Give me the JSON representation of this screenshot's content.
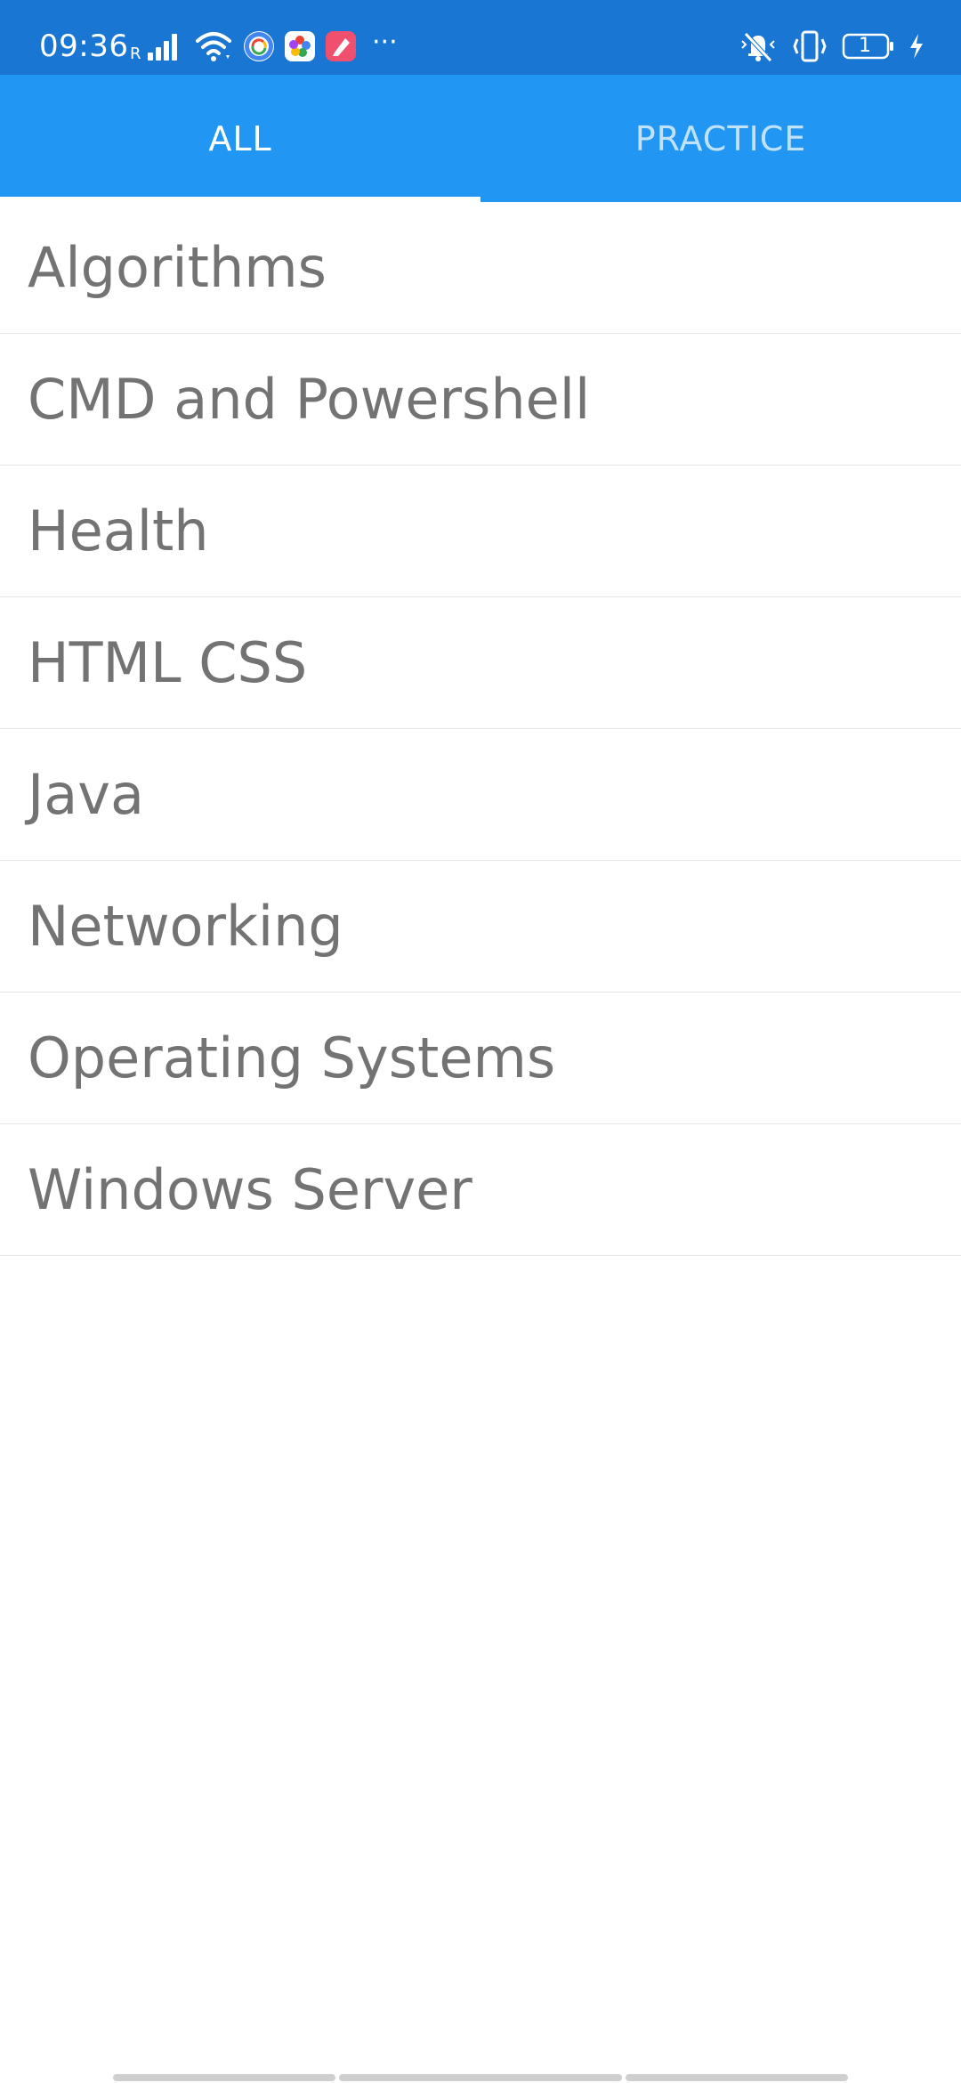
{
  "status_bar": {
    "time": "09:36",
    "network_label": "R",
    "battery_level": "1",
    "more_indicator": "···",
    "icons": [
      "signal-icon",
      "wifi-icon",
      "gpay-icon",
      "photos-icon",
      "notes-app-icon",
      "vibrate-icon",
      "battery-icon",
      "charging-icon"
    ],
    "colors": {
      "background": "#1976D2"
    }
  },
  "tabs": [
    {
      "label": "ALL",
      "selected": true
    },
    {
      "label": "PRACTICE",
      "selected": false
    }
  ],
  "topics": [
    "Algorithms",
    "CMD and Powershell",
    "Health",
    "HTML CSS",
    "Java",
    "Networking",
    "Operating Systems",
    "Windows Server"
  ],
  "colors": {
    "toolbar": "#2196F3",
    "indicator": "#FFFFFF",
    "item_text": "#737373",
    "divider": "#E4E4E4"
  }
}
